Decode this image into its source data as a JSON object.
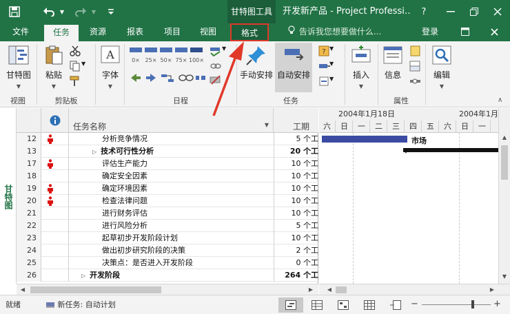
{
  "window": {
    "context_tab_title": "甘特图工具",
    "doc_title": "开发新产品 - Project Professi…",
    "help_label": "?"
  },
  "ribbon_tabs": [
    {
      "label": "文件"
    },
    {
      "label": "任务"
    },
    {
      "label": "资源"
    },
    {
      "label": "报表"
    },
    {
      "label": "项目"
    },
    {
      "label": "视图"
    },
    {
      "label": "格式"
    }
  ],
  "tellme": "告诉我您想要做什么...",
  "login": "登录",
  "ribbon": {
    "gantt_btn": "甘特图",
    "paste_btn": "粘贴",
    "font_btn": "字体",
    "manual_btn": "手动安排",
    "auto_btn": "自动安排",
    "insert_btn": "插入",
    "info_btn": "信息",
    "edit_btn": "编辑",
    "groups": {
      "view": "视图",
      "clipboard": "剪贴板",
      "schedule": "日程",
      "tasks": "任务",
      "properties": "属性"
    },
    "progress_labels": [
      "0×",
      "25×",
      "50×",
      "75×",
      "100×"
    ]
  },
  "grid": {
    "col_name": "任务名称",
    "col_dur": "工期",
    "rows": [
      {
        "id": "12",
        "name": "分析竞争情况",
        "dur": "5 个工",
        "person": true,
        "summary": false,
        "arrow": ""
      },
      {
        "id": "13",
        "name": "技术可行性分析",
        "dur": "20 个工",
        "person": false,
        "summary": true,
        "arrow": "▷"
      },
      {
        "id": "17",
        "name": "评估生产能力",
        "dur": "10 个工",
        "person": true,
        "summary": false,
        "arrow": ""
      },
      {
        "id": "18",
        "name": "确定安全因素",
        "dur": "10 个工",
        "person": false,
        "summary": false,
        "arrow": ""
      },
      {
        "id": "19",
        "name": "确定环境因素",
        "dur": "10 个工",
        "person": true,
        "summary": false,
        "arrow": ""
      },
      {
        "id": "20",
        "name": "检查法律问题",
        "dur": "10 个工",
        "person": true,
        "summary": false,
        "arrow": ""
      },
      {
        "id": "21",
        "name": "进行财务评估",
        "dur": "10 个工",
        "person": false,
        "summary": false,
        "arrow": ""
      },
      {
        "id": "22",
        "name": "进行风险分析",
        "dur": "5 个工",
        "person": false,
        "summary": false,
        "arrow": ""
      },
      {
        "id": "23",
        "name": "起草初步开发阶段计划",
        "dur": "10 个工",
        "person": false,
        "summary": false,
        "arrow": ""
      },
      {
        "id": "24",
        "name": "做出初步研究阶段的决策",
        "dur": "2 个工",
        "person": false,
        "summary": false,
        "arrow": ""
      },
      {
        "id": "25",
        "name": "决策点：是否进入开发阶段",
        "dur": "0 个工",
        "person": false,
        "summary": false,
        "arrow": ""
      },
      {
        "id": "26",
        "name": "开发阶段",
        "dur": "264 个工",
        "person": false,
        "summary": true,
        "arrow": "▷"
      }
    ]
  },
  "chart": {
    "week1": "2004年1月18日",
    "week2": "2004年1月",
    "days": [
      "六",
      "日",
      "一",
      "二",
      "三",
      "四",
      "五",
      "六",
      "日",
      "一"
    ],
    "market_label": "市场"
  },
  "side_label": "甘特图",
  "status": {
    "ready": "就绪",
    "new_task": "新任务: 自动计划"
  },
  "colors": {
    "brand": "#217346",
    "annotation": "#e0392a",
    "task_bar": "#3b4ba3"
  }
}
